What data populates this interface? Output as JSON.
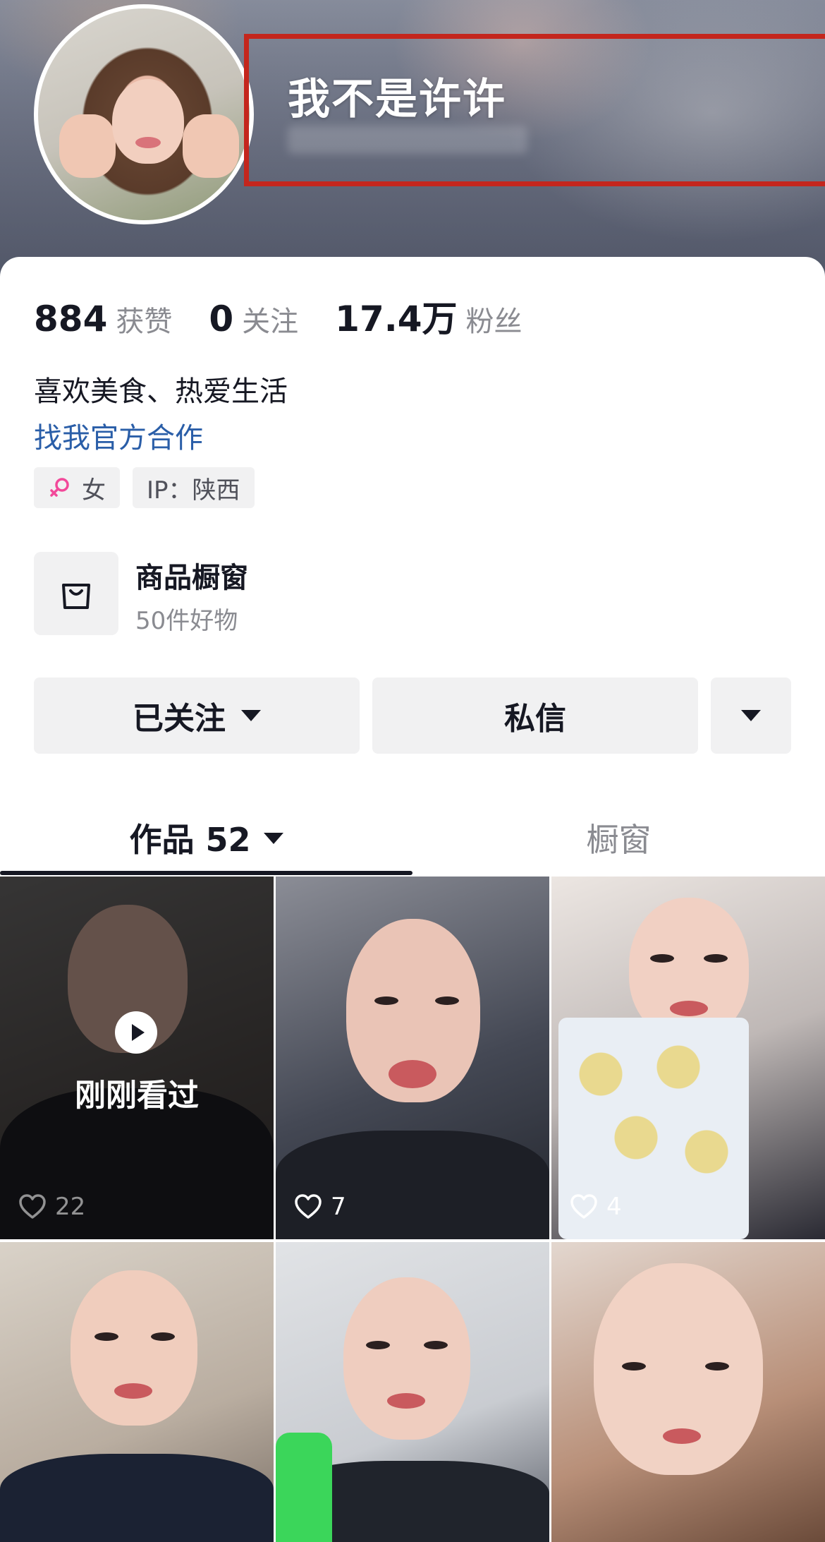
{
  "profile": {
    "name": "我不是许许",
    "stats": [
      {
        "num": "884",
        "label": "获赞"
      },
      {
        "num": "0",
        "label": "关注"
      },
      {
        "num": "17.4万",
        "label": "粉丝"
      }
    ],
    "bio": "喜欢美食、热爱生活",
    "bio_link": "找我官方合作",
    "tags": {
      "gender": "女",
      "ip": "IP：陕西"
    }
  },
  "shop": {
    "title": "商品橱窗",
    "subtitle": "50件好物"
  },
  "actions": {
    "follow": "已关注",
    "message": "私信"
  },
  "tabs": {
    "works": "作品 52",
    "showcase": "橱窗"
  },
  "videos": [
    {
      "likes": "22",
      "overlay": "刚刚看过"
    },
    {
      "likes": "7"
    },
    {
      "likes": "4"
    },
    {},
    {},
    {}
  ],
  "colors": {
    "accent_link": "#2a5ea8",
    "highlight_box": "#c4261d",
    "female_icon": "#f2499a"
  }
}
